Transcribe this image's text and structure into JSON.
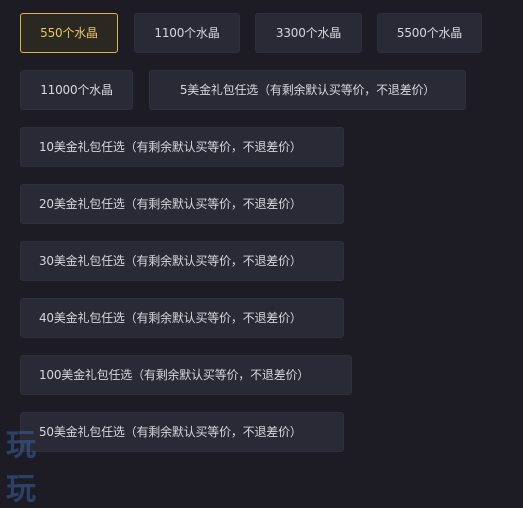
{
  "options": {
    "opt_550": "550个水晶",
    "opt_1100": "1100个水晶",
    "opt_3300": "3300个水晶",
    "opt_5500": "5500个水晶",
    "opt_11000": "11000个水晶",
    "opt_5usd": "5美金礼包任选（有剩余默认买等价，不退差价）",
    "opt_10usd": "10美金礼包任选（有剩余默认买等价，不退差价）",
    "opt_20usd": "20美金礼包任选（有剩余默认买等价，不退差价）",
    "opt_30usd": "30美金礼包任选（有剩余默认买等价，不退差价）",
    "opt_40usd": "40美金礼包任选（有剩余默认买等价，不退差价）",
    "opt_100usd": "100美金礼包任选（有剩余默认买等价，不退差价）",
    "opt_50usd": "50美金礼包任选（有剩余默认买等价，不退差价）"
  },
  "selected_option": "550个水晶",
  "watermark": {
    "char1": "玩",
    "char2": "玩"
  },
  "colors": {
    "background": "#1d1c25",
    "button_bg": "#2a2a37",
    "selected_border": "#e0b24a",
    "selected_text": "#e7c46b",
    "text": "#d6d6dc"
  }
}
